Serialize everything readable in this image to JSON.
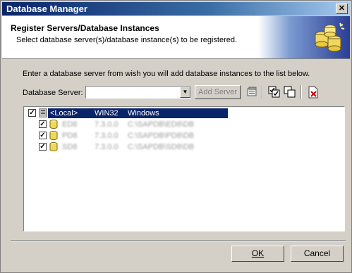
{
  "window": {
    "title": "Database Manager"
  },
  "header": {
    "title": "Register Servers/Database Instances",
    "subtitle": "Select database server(s)/database instance(s) to be registered."
  },
  "instructions": "Enter a database server from wish you will add database instances to the list below.",
  "toolbar": {
    "database_server_label": "Database Server:",
    "database_server_value": "",
    "add_server_label": "Add Server"
  },
  "tree": {
    "root": {
      "name": "<Local>",
      "platform": "WIN32",
      "os": "Windows",
      "checked": true
    },
    "children": [
      {
        "name": "ED8",
        "version": "7.3.0.0",
        "path": "C:\\SAPDB\\ED8\\DB",
        "checked": true
      },
      {
        "name": "PD8",
        "version": "7.3.0.0",
        "path": "C:\\SAPDB\\PD8\\DB",
        "checked": true
      },
      {
        "name": "SD8",
        "version": "7.3.0.0",
        "path": "C:\\SAPDB\\SD8\\DB",
        "checked": true
      }
    ]
  },
  "buttons": {
    "ok": "OK",
    "cancel": "Cancel"
  }
}
